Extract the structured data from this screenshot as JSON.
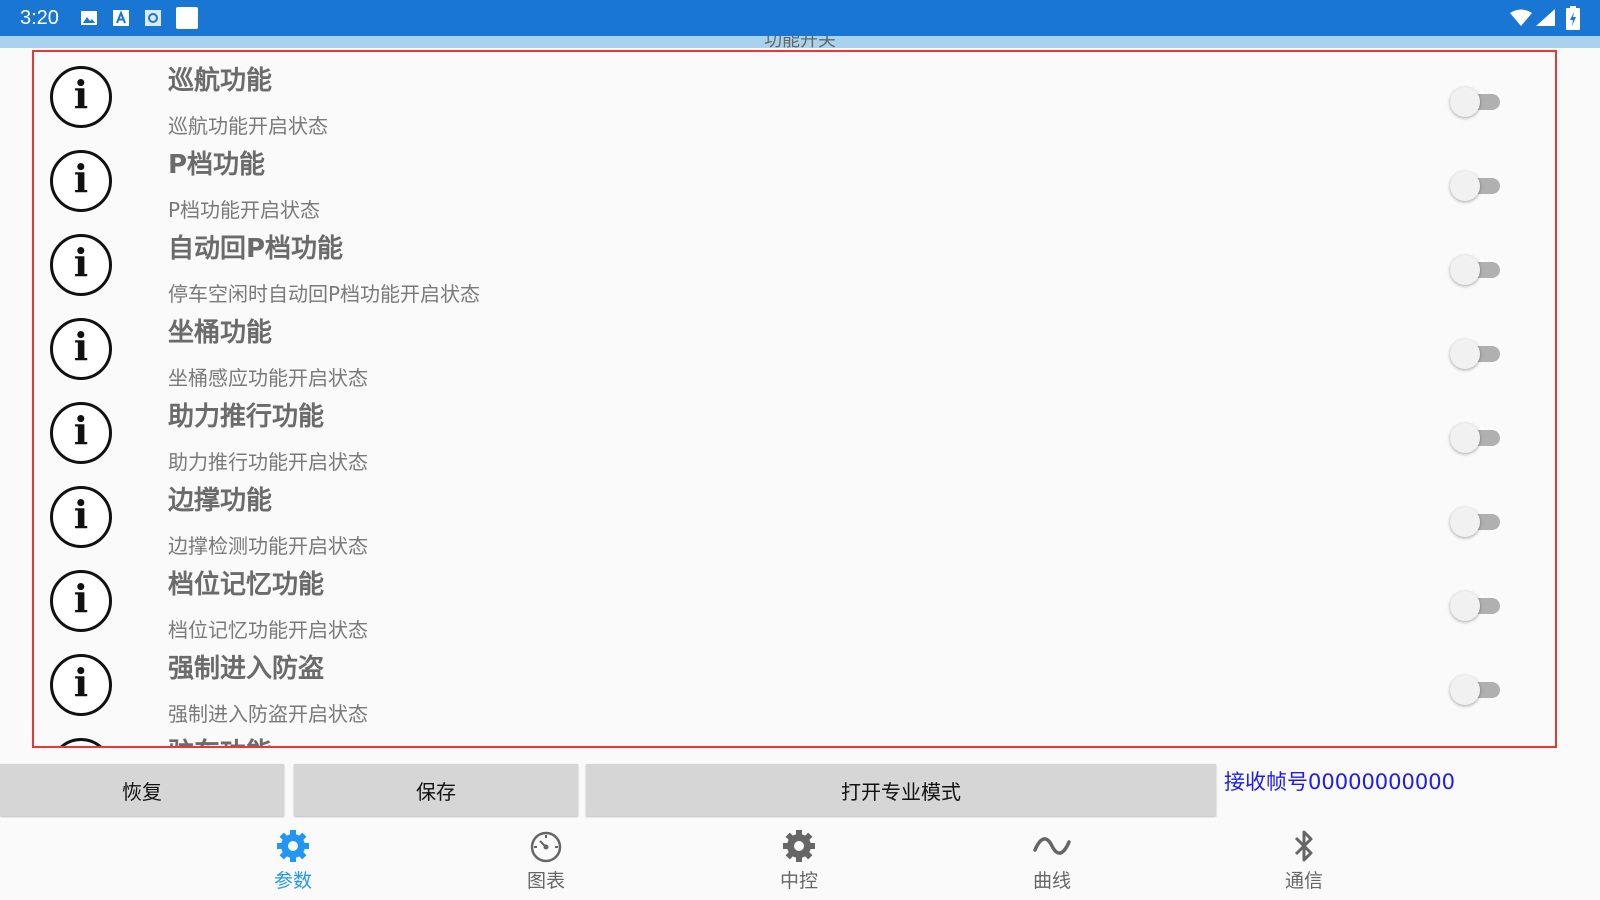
{
  "status_bar": {
    "time": "3:20"
  },
  "header": {
    "title": "功能开关"
  },
  "features": [
    {
      "title": "巡航功能",
      "desc": "巡航功能开启状态",
      "enabled": false
    },
    {
      "title": "P档功能",
      "desc": "P档功能开启状态",
      "enabled": false
    },
    {
      "title": "自动回P档功能",
      "desc": "停车空闲时自动回P档功能开启状态",
      "enabled": false
    },
    {
      "title": "坐桶功能",
      "desc": "坐桶感应功能开启状态",
      "enabled": false
    },
    {
      "title": "助力推行功能",
      "desc": "助力推行功能开启状态",
      "enabled": false
    },
    {
      "title": "边撑功能",
      "desc": "边撑检测功能开启状态",
      "enabled": false
    },
    {
      "title": "档位记忆功能",
      "desc": "档位记忆功能开启状态",
      "enabled": false
    },
    {
      "title": "强制进入防盗",
      "desc": "强制进入防盗开启状态",
      "enabled": false
    },
    {
      "title": "驻车功能",
      "desc": "",
      "enabled": false
    }
  ],
  "info_glyph": "i",
  "actions": {
    "restore": "恢复",
    "save": "保存",
    "pro_mode": "打开专业模式"
  },
  "frame_label": "接收帧号00000000000",
  "nav": [
    {
      "label": "参数",
      "icon": "gear-icon",
      "active": true
    },
    {
      "label": "图表",
      "icon": "gauge-icon",
      "active": false
    },
    {
      "label": "中控",
      "icon": "gear-icon",
      "active": false
    },
    {
      "label": "曲线",
      "icon": "wave-icon",
      "active": false
    },
    {
      "label": "通信",
      "icon": "bluetooth-icon",
      "active": false
    }
  ],
  "colors": {
    "status_bar": "#1976d2",
    "active_nav": "#2196f3",
    "highlight_border": "#e53935",
    "frame_text": "#1a1aff"
  }
}
